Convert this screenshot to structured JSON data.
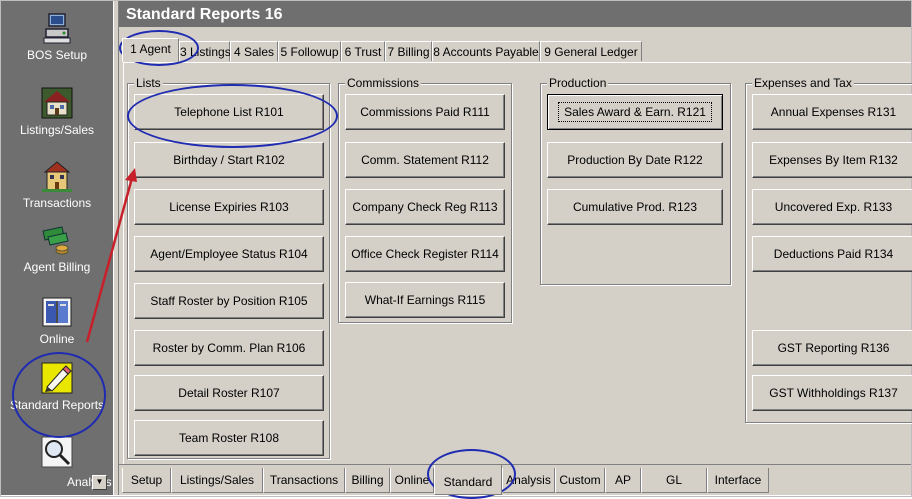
{
  "sidebar": {
    "items": [
      {
        "label": "BOS Setup",
        "icon": "computer-icon"
      },
      {
        "label": "Listings/Sales",
        "icon": "house-icon"
      },
      {
        "label": "Transactions",
        "icon": "building-icon"
      },
      {
        "label": "Agent Billing",
        "icon": "money-icon"
      },
      {
        "label": "Online",
        "icon": "book-icon"
      },
      {
        "label": "Standard Reports",
        "icon": "pencil-icon"
      },
      {
        "label": "Analysis",
        "icon": "magnifier-icon"
      }
    ]
  },
  "window": {
    "title": "Standard Reports 16"
  },
  "tabs": [
    "1 Agent",
    "3 Listings",
    "4 Sales",
    "5 Followup",
    "6 Trust",
    "7 Billing",
    "8 Accounts Payable",
    "9 General Ledger"
  ],
  "groups": {
    "lists": {
      "title": "Lists",
      "buttons": [
        "Telephone List  R101",
        "Birthday / Start  R102",
        "License Expiries  R103",
        "Agent/Employee Status  R104",
        "Staff Roster by Position  R105",
        "Roster by Comm. Plan  R106",
        "Detail Roster  R107",
        "Team Roster  R108"
      ]
    },
    "commissions": {
      "title": "Commissions",
      "buttons": [
        "Commissions Paid  R111",
        "Comm. Statement  R112",
        "Company Check Reg R113",
        "Office Check Register R114",
        "What-If Earnings R115"
      ]
    },
    "production": {
      "title": "Production",
      "buttons": [
        "Sales Award & Earn. R121",
        "Production By Date R122",
        "Cumulative Prod. R123"
      ]
    },
    "expenses": {
      "title": "Expenses and Tax",
      "buttons": [
        "Annual Expenses  R131",
        "Expenses By Item  R132",
        "Uncovered Exp.  R133",
        "Deductions Paid  R134",
        "GST Reporting  R136",
        "GST Withholdings  R137"
      ]
    }
  },
  "bottom_tabs": [
    "Setup",
    "Listings/Sales",
    "Transactions",
    "Billing",
    "Online",
    "Standard",
    "Analysis",
    "Custom",
    "AP",
    "GL",
    "Interface"
  ],
  "colors": {
    "annotation": "#1f2bb0",
    "arrow": "#c8202a",
    "panel": "#d4d0c8",
    "sidebar": "#6f6f6f"
  }
}
